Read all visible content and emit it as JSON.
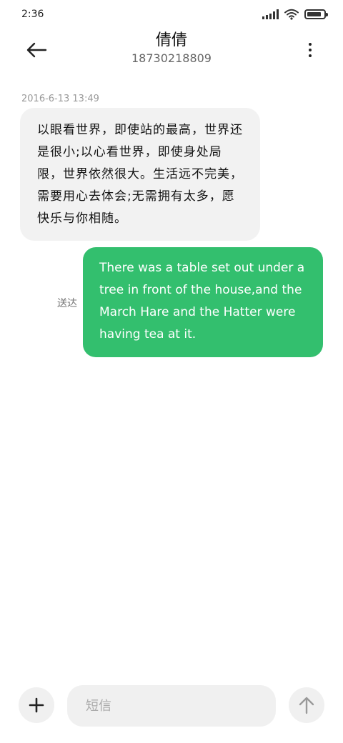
{
  "status_bar": {
    "time": "2:36",
    "battery_level": 0.85,
    "icons": [
      "signal-icon",
      "wifi-icon",
      "battery-icon"
    ]
  },
  "header": {
    "contact_name": "倩倩",
    "contact_number": "18730218809",
    "icons": [
      "back-arrow-icon",
      "more-vertical-icon"
    ]
  },
  "conversation": {
    "timestamp": "2016-6-13 13:49",
    "incoming_message": "以眼看世界，即使站的最高，世界还是很小;以心看世界，即使身处局限，世界依然很大。生活远不完美，需要用心去体会;无需拥有太多，愿快乐与你相随。",
    "outgoing_status": "送达",
    "outgoing_message": "There was a table set out under a tree in front of the house,and the March Hare and the Hatter were having tea at it."
  },
  "composer": {
    "placeholder": "短信",
    "value": "",
    "icons": [
      "plus-icon",
      "send-arrow-icon"
    ]
  },
  "colors": {
    "outgoing_bubble": "#33bf6e",
    "incoming_bubble": "#f2f2f2",
    "button_background": "#f0f0f0"
  }
}
